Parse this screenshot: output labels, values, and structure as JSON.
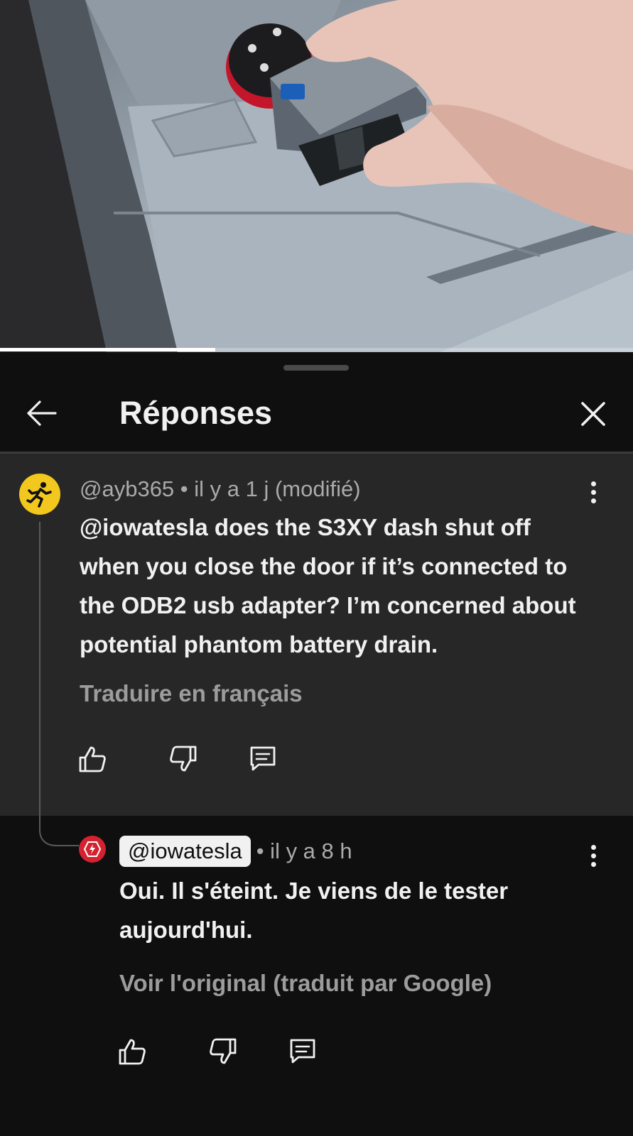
{
  "video": {
    "progress_percent": 34
  },
  "sheet": {
    "title": "Réponses"
  },
  "parent_comment": {
    "author": "@ayb365",
    "separator": " • ",
    "time": "il y a 1 j (modifié)",
    "text": "@iowatesla does the S3XY dash shut off when you close the door if it’s connected to the ODB2 usb adapter? I’m concerned about potential phantom battery drain.",
    "translate_label": "Traduire en français",
    "avatar_icon": "running-person-icon",
    "avatar_color": "#f2c81e"
  },
  "reply": {
    "author": "@iowatesla",
    "time": "• il y a 8 h",
    "text": "Oui. Il s'éteint. Je viens de le tester aujourd'hui.",
    "translate_label": "Voir l'original (traduit par Google)",
    "avatar_icon": "lightning-badge-icon",
    "avatar_color": "#d42230"
  },
  "icons": {
    "back": "arrow-left-icon",
    "close": "close-icon",
    "more": "more-vert-icon",
    "like": "thumb-up-icon",
    "dislike": "thumb-down-icon",
    "reply": "reply-comment-icon"
  }
}
